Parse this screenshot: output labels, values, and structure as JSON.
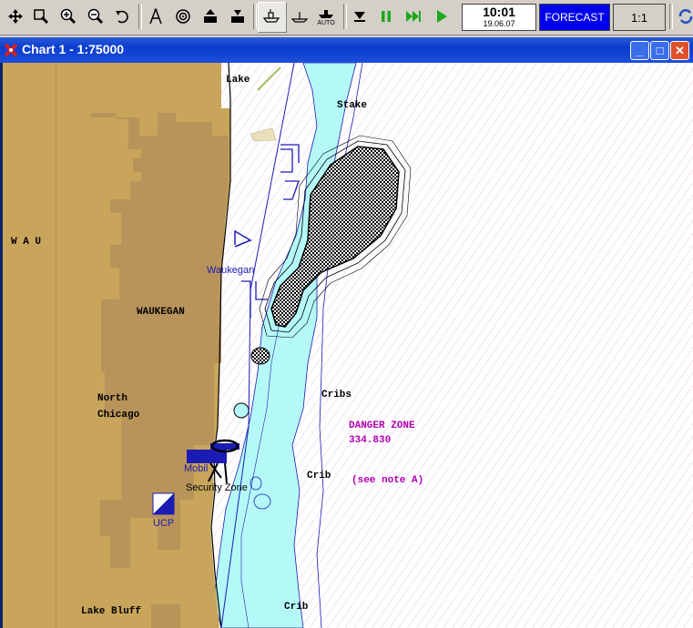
{
  "toolbar": {
    "tools": [
      "move-tool-icon",
      "zoom-window-icon",
      "zoom-in-icon",
      "zoom-out-icon",
      "undo-icon",
      "compass-icon",
      "target-icon",
      "ship-up-icon",
      "ship-load-icon",
      "ship-mode-1-icon",
      "ship-mode-2-icon",
      "ship-auto-icon",
      "stop-icon",
      "pause-icon",
      "fast-forward-icon",
      "play-icon"
    ],
    "auto_label": "AUTO",
    "time": "10:01",
    "date": "19.06.07",
    "forecast_label": "FORECAST",
    "scale_label": "1:1"
  },
  "window": {
    "title": "Chart 1 - 1:75000",
    "minimize": "_",
    "maximize": "□",
    "close": "✕"
  },
  "chart_labels": {
    "lake_top": "Lake",
    "stake": "Stake",
    "wau": "W A U",
    "waukegan_town": "Waukegan",
    "waukegan_area": "WAUKEGAN",
    "north": "North",
    "chicago": "Chicago",
    "cribs": "Cribs",
    "danger_zone": "DANGER ZONE",
    "danger_code": "334.830",
    "crib_mid": "Crib",
    "see_note": "(see note A)",
    "mobil": "Mobil",
    "security_zone": "Security Zone",
    "ucp": "UCP",
    "lake_bluff": "Lake Bluff",
    "crib_bottom": "Crib"
  },
  "colors": {
    "land": "#c8a55a",
    "shallow_water": "#b4f8f8",
    "deep_water": "#ffffff",
    "chart_blue": "#1c1cb4",
    "danger_magenta": "#b000b0",
    "forecast_bg": "#0000ee"
  }
}
